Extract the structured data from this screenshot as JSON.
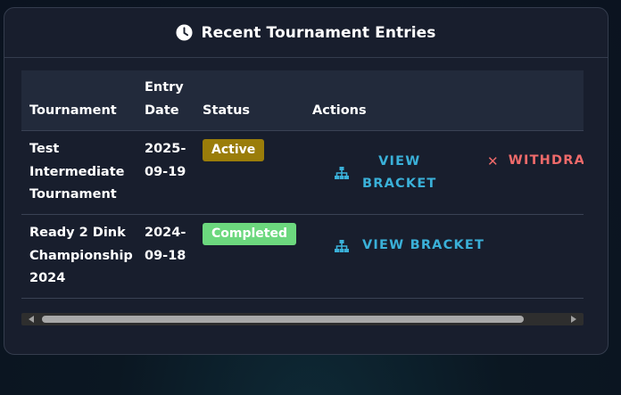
{
  "header": {
    "title": "Recent Tournament Entries",
    "icon": "clock-icon"
  },
  "table": {
    "columns": [
      "Tournament",
      "Entry Date",
      "Status",
      "Actions"
    ],
    "rows": [
      {
        "tournament_lines": [
          "Test",
          "Intermediate",
          "Tournament"
        ],
        "entry_date_lines": [
          "2025-",
          "09-19"
        ],
        "status": "Active",
        "actions": {
          "view_lines": [
            "VIEW",
            "BRACKET"
          ],
          "withdraw": "WITHDRA"
        }
      },
      {
        "tournament_lines": [
          "Ready 2 Dink",
          "Championship",
          "2024"
        ],
        "entry_date_lines": [
          "2024-",
          "09-18"
        ],
        "status": "Completed",
        "actions": {
          "view": "VIEW BRACKET"
        }
      }
    ]
  },
  "colors": {
    "active_badge": "#9a7d0a",
    "completed_badge": "#6cd87e",
    "link": "#3ab0d8",
    "danger": "#ee6a6a"
  }
}
